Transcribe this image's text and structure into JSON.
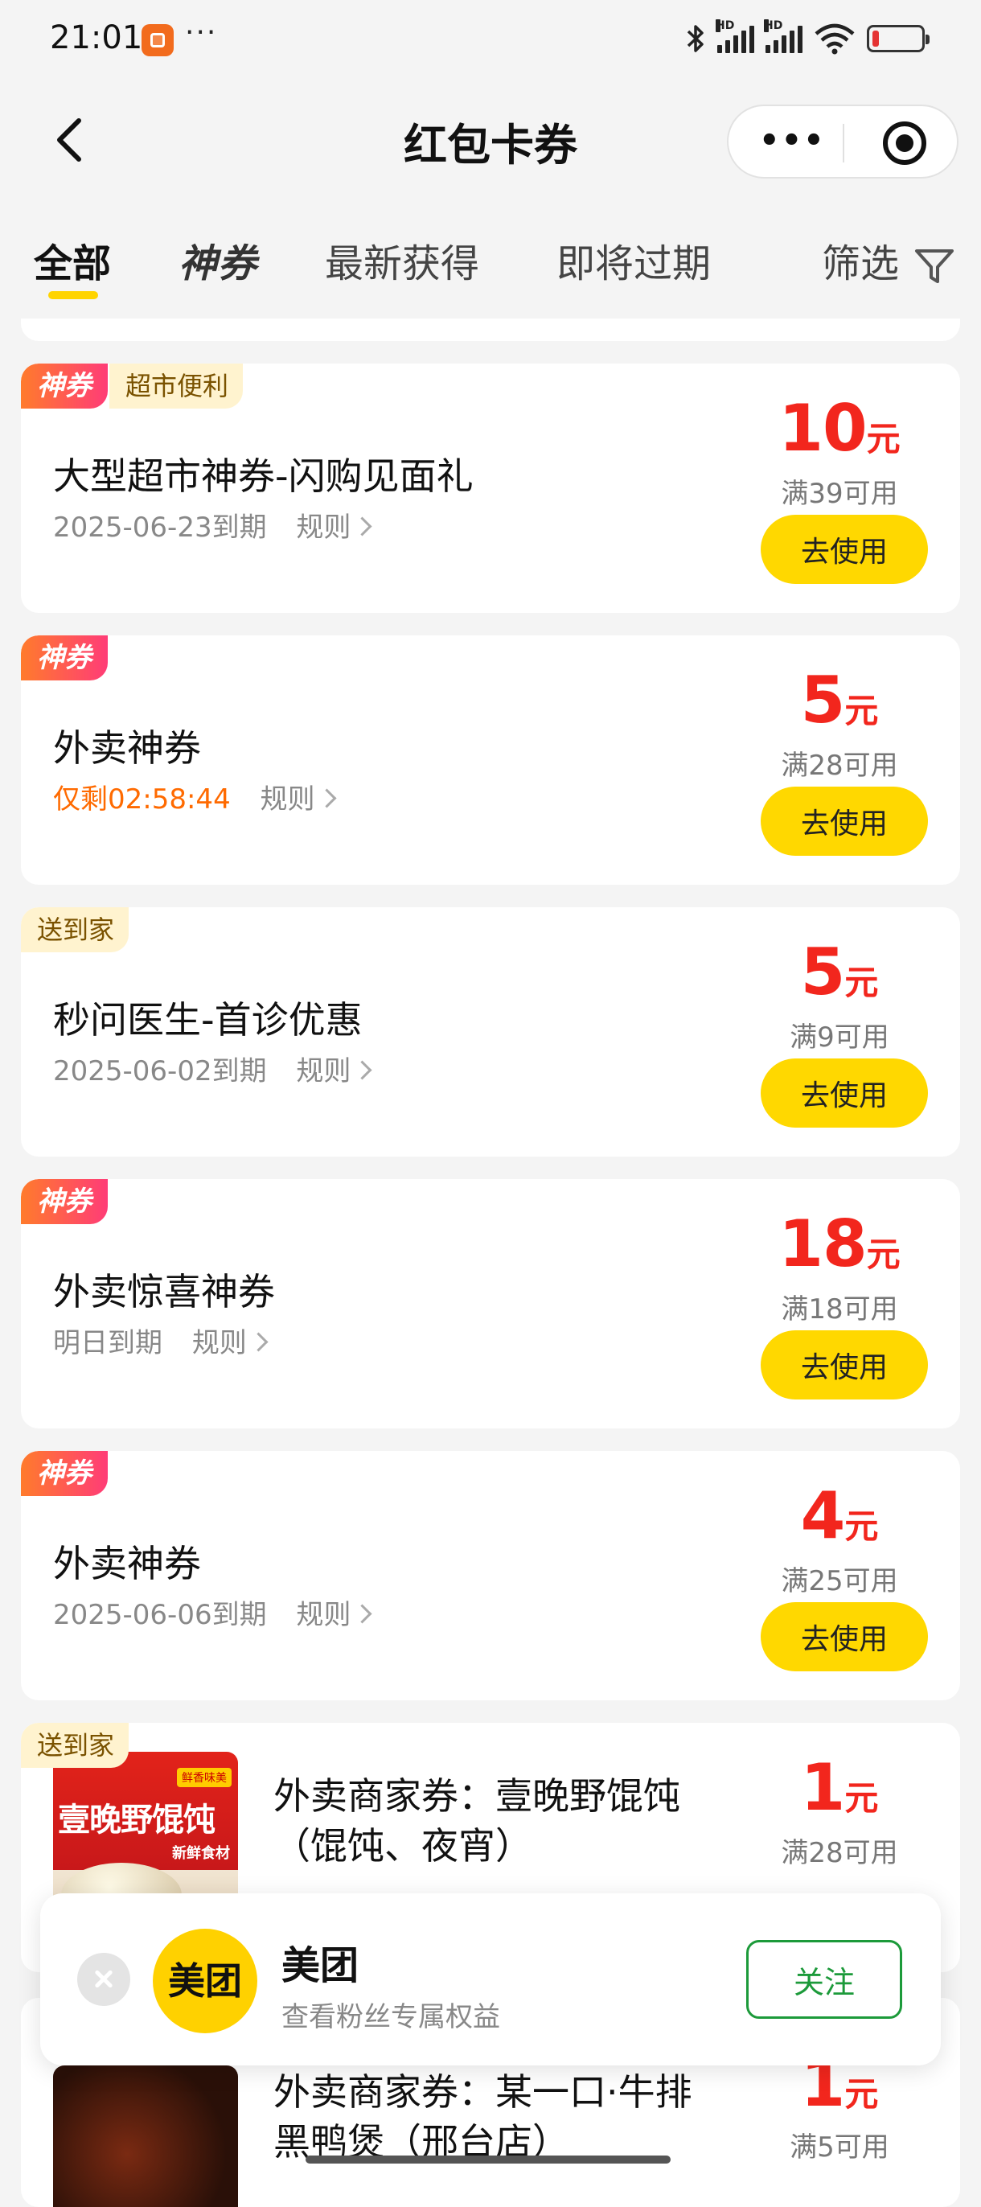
{
  "status_bar": {
    "time": "21:01",
    "more": "···",
    "icons": [
      "app-notification-icon",
      "bluetooth-icon",
      "signal-hd-icon",
      "signal-hd-icon",
      "wifi-icon",
      "battery-low-icon"
    ],
    "network_tag": "HD",
    "colors": {
      "battery_low": "#e53333"
    }
  },
  "nav": {
    "title": "红包卡券",
    "capsule_more": "•••",
    "icons": [
      "back-chevron-icon",
      "more-dots-icon",
      "target-icon"
    ]
  },
  "tabs": [
    {
      "label": "全部",
      "active": true
    },
    {
      "label": "神券",
      "active": false
    },
    {
      "label": "最新获得",
      "active": false
    },
    {
      "label": "即将过期",
      "active": false
    },
    {
      "label": "筛选",
      "active": false,
      "icon": "filter-funnel-icon"
    }
  ],
  "coupons": [
    {
      "badge": "神券",
      "category": "超市便利",
      "title": "大型超市神券-闪购见面礼",
      "expiry": "2025-06-23到期",
      "rule": "规则",
      "amount": "10",
      "unit": "元",
      "condition": "满39可用",
      "button": "去使用"
    },
    {
      "badge": "神券",
      "title": "外卖神券",
      "countdown": "仅剩02:58:44",
      "rule": "规则",
      "amount": "5",
      "unit": "元",
      "condition": "满28可用",
      "button": "去使用"
    },
    {
      "category": "送到家",
      "title": "秒问医生-首诊优惠",
      "expiry": "2025-06-02到期",
      "rule": "规则",
      "amount": "5",
      "unit": "元",
      "condition": "满9可用",
      "button": "去使用"
    },
    {
      "badge": "神券",
      "title": "外卖惊喜神券",
      "expiry": "明日到期",
      "rule": "规则",
      "amount": "18",
      "unit": "元",
      "condition": "满18可用",
      "button": "去使用"
    },
    {
      "badge": "神券",
      "title": "外卖神券",
      "expiry": "2025-06-06到期",
      "rule": "规则",
      "amount": "4",
      "unit": "元",
      "condition": "满25可用",
      "button": "去使用"
    },
    {
      "category": "送到家",
      "title": "外卖商家券：壹晚野馄饨（馄饨、夜宵）",
      "amount": "1",
      "unit": "元",
      "condition": "满28可用",
      "thumb_text": "壹晚野馄饨",
      "thumb_tag": "鲜香味美",
      "thumb_sub": "新鲜食材"
    },
    {
      "title": "外卖商家券：某一口·牛排黑鸭煲（邢台店）",
      "amount": "1",
      "unit": "元",
      "condition": "满5可用"
    }
  ],
  "follow_bar": {
    "logo_text": "美团",
    "name": "美团",
    "desc": "查看粉丝专属权益",
    "button": "关注",
    "colors": {
      "logo": "#ffd100",
      "follow": "#1c9a3a"
    }
  },
  "colors": {
    "accent_yellow": "#ffd800",
    "amount_red": "#f2261d",
    "countdown_orange": "#ff6a00",
    "page_bg": "#f4f4f4"
  }
}
